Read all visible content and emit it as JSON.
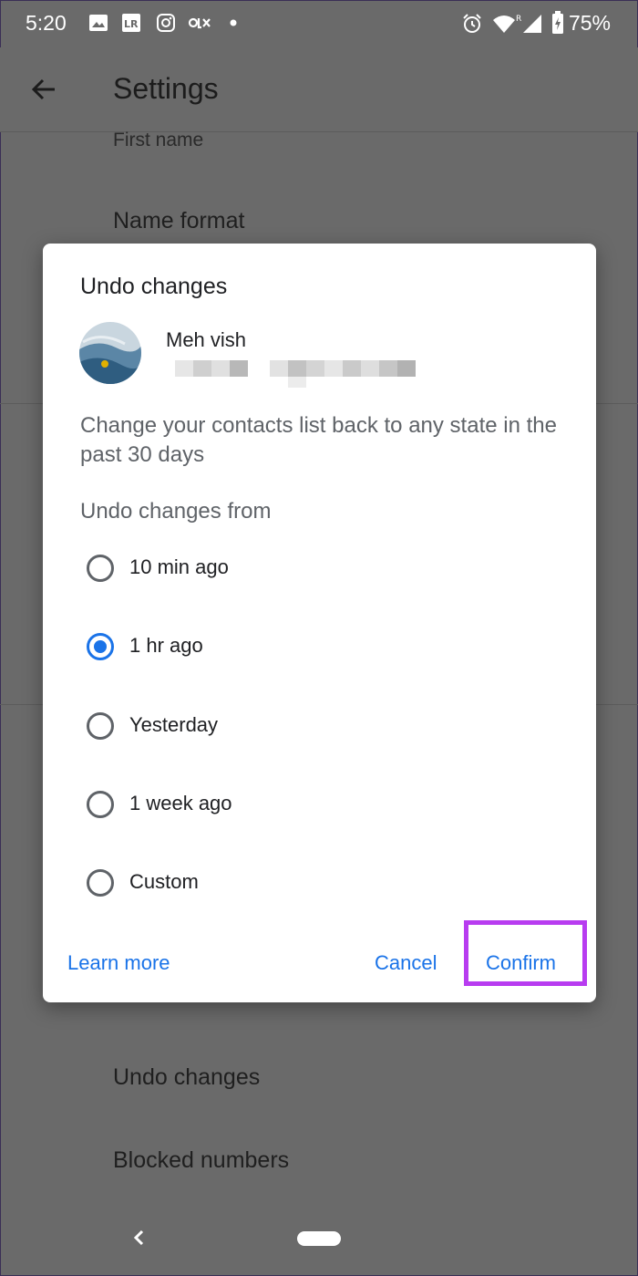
{
  "status_bar": {
    "time": "5:20",
    "battery": "75%",
    "icons": [
      "image-icon",
      "lr-icon",
      "instagram-icon",
      "olx-icon",
      "dot-icon",
      "alarm-icon",
      "wifi-icon",
      "signal-icon",
      "battery-icon"
    ]
  },
  "app_bar": {
    "title": "Settings",
    "back_icon": "back-arrow-icon"
  },
  "background_list": {
    "first_name": "First name",
    "name_format": "Name format",
    "undo_changes": "Undo changes",
    "blocked_numbers": "Blocked numbers"
  },
  "dialog": {
    "title": "Undo changes",
    "account_name": "Meh vish",
    "description": "Change your contacts list back to any state in the past 30 days",
    "undo_from_label": "Undo changes from",
    "options": [
      {
        "label": "10 min ago",
        "selected": false
      },
      {
        "label": "1 hr ago",
        "selected": true
      },
      {
        "label": "Yesterday",
        "selected": false
      },
      {
        "label": "1 week ago",
        "selected": false
      },
      {
        "label": "Custom",
        "selected": false
      }
    ],
    "learn_more": "Learn more",
    "cancel": "Cancel",
    "confirm": "Confirm"
  },
  "colors": {
    "accent": "#1a73e8",
    "highlight": "#b83cf0",
    "scrim": "#6a6a6a"
  }
}
